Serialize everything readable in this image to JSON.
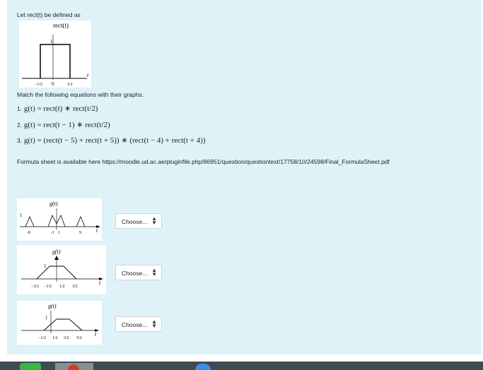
{
  "question": {
    "intro": "Let rect(t) be defined as",
    "instruction": "Match the following equations with their graphs.",
    "equations": [
      {
        "num": "1.",
        "expr": "g(t) = rect(t) ∗ rect(t/2)"
      },
      {
        "num": "2.",
        "expr": "g(t) = rect(t − 1) ∗ rect(t/2)"
      },
      {
        "num": "3.",
        "expr": "g(t) = (rect(t − 5) + rect(t + 5)) ∗ (rect(t − 4) + rect(t + 4))"
      }
    ],
    "formula_sheet": "Formula sheet is available here https://moodle.ud.ac.ae/pluginfile.php/86951/question/questiontext/17758/10/24598/Final_FormulaSheet.pdf"
  },
  "rect_figure": {
    "title": "rect(t)",
    "amp": "1",
    "t": "t",
    "zero": "0",
    "neg_half": "−1/2",
    "pos_half": "1/2"
  },
  "graphs": [
    {
      "ylabel": "g(t)",
      "amp": "1",
      "t": "t",
      "ticks": [
        "-9",
        "-1",
        "1",
        "9"
      ]
    },
    {
      "ylabel": "g(t)",
      "amp": "1",
      "t": "t",
      "ticks": [
        "−3/2",
        "−1/2",
        "1/2",
        "3/2"
      ]
    },
    {
      "ylabel": "g(t)",
      "amp": "1",
      "t": "t",
      "ticks": [
        "−1/2",
        "1/2",
        "3/2",
        "5/2"
      ]
    }
  ],
  "answers": [
    {
      "selected": "Choose..."
    },
    {
      "selected": "Choose..."
    },
    {
      "selected": "Choose..."
    }
  ],
  "colors": {
    "panel_bg": "#def2f8",
    "text": "#1d2125",
    "taskbar": "#3f4b50"
  }
}
